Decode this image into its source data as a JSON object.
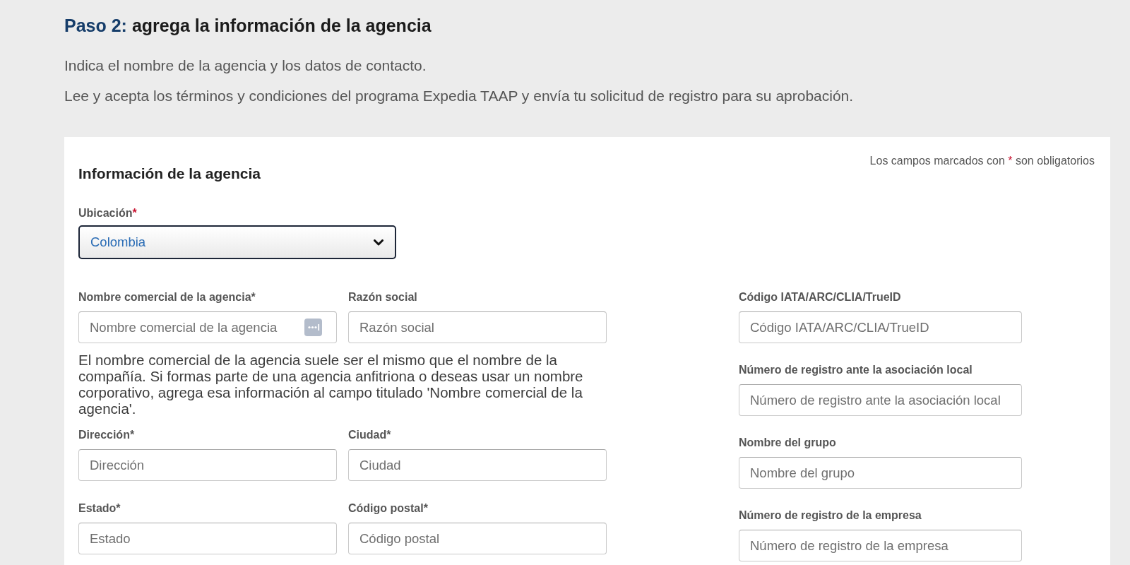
{
  "header": {
    "step": "Paso 2:",
    "title": "agrega la información de la agencia"
  },
  "intro": [
    "Indica el nombre de la agencia y los datos de contacto.",
    "Lee y acepta los términos y condiciones del programa Expedia TAAP y envía tu solicitud de registro para su aprobación."
  ],
  "card": {
    "required_note": {
      "before": "Los campos marcados con",
      "mark": "*",
      "after": "son obligatorios"
    },
    "title": "Información de la agencia",
    "location": {
      "label": "Ubicación",
      "mark": "*",
      "value": "Colombia",
      "focused": true
    },
    "left_rows": [
      {
        "fields": [
          {
            "kind": "text_with_icon",
            "label": "Nombre comercial de la agencia*",
            "placeholder": "Nombre comercial de la agencia"
          },
          {
            "kind": "text",
            "label": "Razón social",
            "placeholder": "Razón social"
          }
        ],
        "help": "El nombre comercial de la agencia suele ser el mismo que el nombre de la compañía. Si formas parte de una agencia anfitriona o deseas usar un nombre corporativo, agrega esa información al campo titulado 'Nombre comercial de la agencia'."
      },
      {
        "fields": [
          {
            "kind": "text",
            "label": "Dirección*",
            "placeholder": "Dirección"
          },
          {
            "kind": "text",
            "label": "Ciudad*",
            "placeholder": "Ciudad"
          }
        ]
      },
      {
        "fields": [
          {
            "kind": "text",
            "label": "Estado*",
            "placeholder": "Estado"
          },
          {
            "kind": "text",
            "label": "Código postal*",
            "placeholder": "Código postal"
          }
        ]
      }
    ],
    "right_fields": [
      {
        "kind": "text",
        "label": "Código IATA/ARC/CLIA/TrueID",
        "placeholder": "Código IATA/ARC/CLIA/TrueID"
      },
      {
        "kind": "text",
        "label": "Número de registro ante la asociación local",
        "placeholder": "Número de registro ante la asociación local"
      },
      {
        "kind": "text",
        "label": "Nombre del grupo",
        "placeholder": "Nombre del grupo"
      },
      {
        "kind": "text",
        "label": "Número de registro de la empresa",
        "placeholder": "Número de registro de la empresa"
      }
    ]
  }
}
